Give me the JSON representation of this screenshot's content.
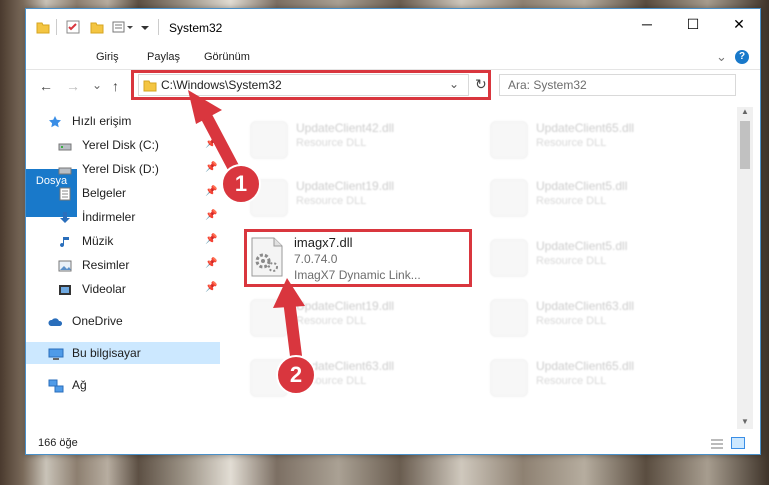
{
  "window": {
    "title": "System32",
    "minimize": "─",
    "maximize": "☐",
    "close": "✕"
  },
  "ribbon": {
    "tabs": [
      "Dosya",
      "Giriş",
      "Paylaş",
      "Görünüm"
    ],
    "expand": "⌄",
    "help": "?"
  },
  "nav": {
    "back": "←",
    "forward": "→",
    "recent": "⌄",
    "up": "↑",
    "address": "C:\\Windows\\System32",
    "dropdown": "⌄",
    "refresh": "↻",
    "search_placeholder": "Ara: System32"
  },
  "sidebar": {
    "quick_access": "Hızlı erişim",
    "items": [
      {
        "label": "Yerel Disk (C:)",
        "pinned": true
      },
      {
        "label": "Yerel Disk (D:)",
        "pinned": true
      },
      {
        "label": "Belgeler",
        "pinned": true
      },
      {
        "label": "İndirmeler",
        "pinned": true
      },
      {
        "label": "Müzik",
        "pinned": true
      },
      {
        "label": "Resimler",
        "pinned": true
      },
      {
        "label": "Videolar",
        "pinned": true
      }
    ],
    "onedrive": "OneDrive",
    "this_pc": "Bu bilgisayar",
    "network": "Ağ"
  },
  "files": {
    "highlighted": {
      "name": "imagx7.dll",
      "version": "7.0.74.0",
      "description": "ImagX7 Dynamic Link..."
    },
    "ghost_left": [
      {
        "name": "UpdateClient42.dll",
        "desc": "Resource DLL"
      },
      {
        "name": "UpdateClient19.dll",
        "desc": "Resource DLL"
      },
      {
        "name": "UpdateClient19.dll",
        "desc": "Resource DLL"
      },
      {
        "name": "UpdateClient63.dll",
        "desc": "Resource DLL"
      }
    ],
    "ghost_right": [
      {
        "name": "UpdateClient65.dll",
        "desc": "Resource DLL"
      },
      {
        "name": "UpdateClient5.dll",
        "desc": "Resource DLL"
      },
      {
        "name": "UpdateClient5.dll",
        "desc": "Resource DLL"
      },
      {
        "name": "UpdateClient63.dll",
        "desc": "Resource DLL"
      },
      {
        "name": "UpdateClient65.dll",
        "desc": "Resource DLL"
      }
    ]
  },
  "status": {
    "count": "166 öğe"
  },
  "annotations": {
    "marker1": "1",
    "marker2": "2",
    "color": "#d9363e"
  }
}
